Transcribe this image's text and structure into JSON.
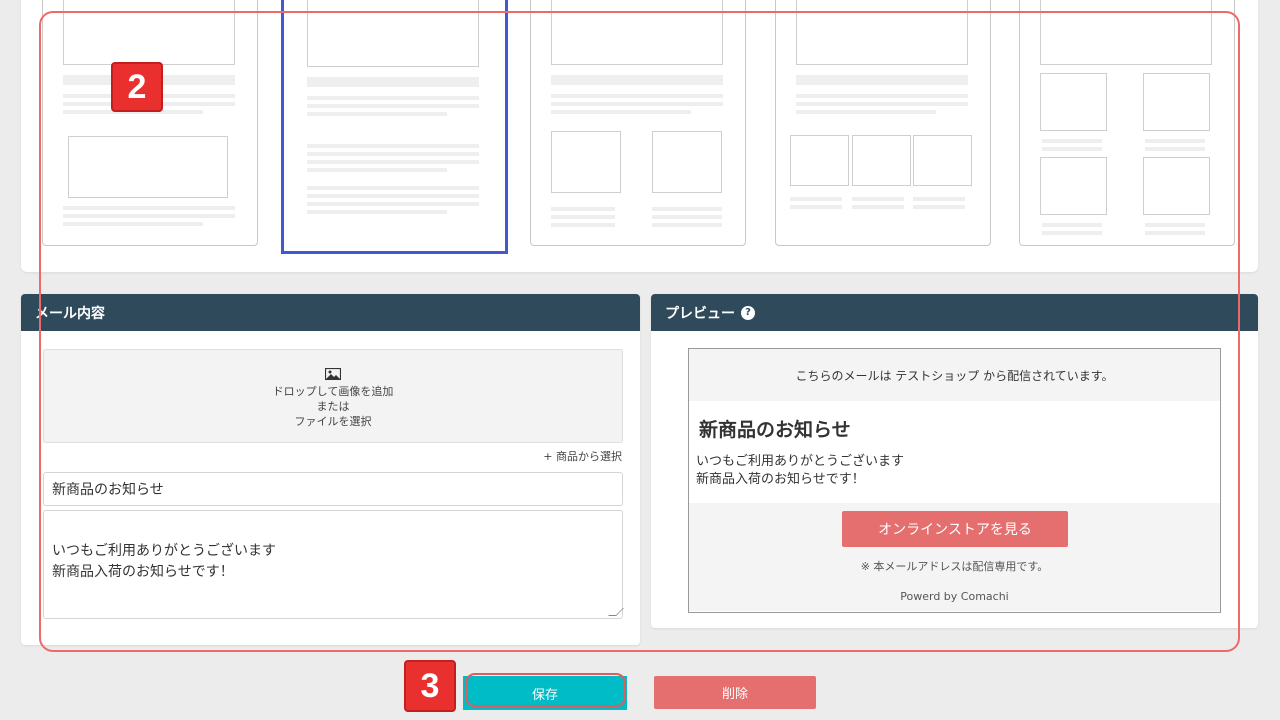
{
  "templates": {
    "items": [
      "layout-1",
      "layout-2",
      "layout-3",
      "layout-4",
      "layout-5"
    ],
    "selected_index": 1
  },
  "mail_content": {
    "header": "メール内容",
    "dropzone": {
      "line1": "ドロップして画像を追加",
      "line2": "または",
      "line3": "ファイルを選択"
    },
    "pick_from_products": "+ 商品から選択",
    "subject": "新商品のお知らせ",
    "body": "いつもご利用ありがとうございます\n新商品入荷のお知らせです！"
  },
  "preview": {
    "header": "プレビュー",
    "sender_notice": "こちらのメールは テストショップ から配信されています。",
    "title": "新商品のお知らせ",
    "body": "いつもご利用ありがとうございます\n新商品入荷のお知らせです！",
    "store_button": "オンラインストアを見る",
    "notice": "※ 本メールアドレスは配信専用です。",
    "powered": "Powerd by Comachi"
  },
  "actions": {
    "save": "保存",
    "delete": "削除"
  },
  "annotations": {
    "step2": "2",
    "step3": "3",
    "highlight_color": "#ec6a6a",
    "badge_color": "#ea2f2f"
  },
  "colors": {
    "header_bg": "#2e4a5b",
    "save_bg": "#00bcc7",
    "delete_bg": "#e56f6f",
    "selected_template_border": "#3f5ad3"
  }
}
